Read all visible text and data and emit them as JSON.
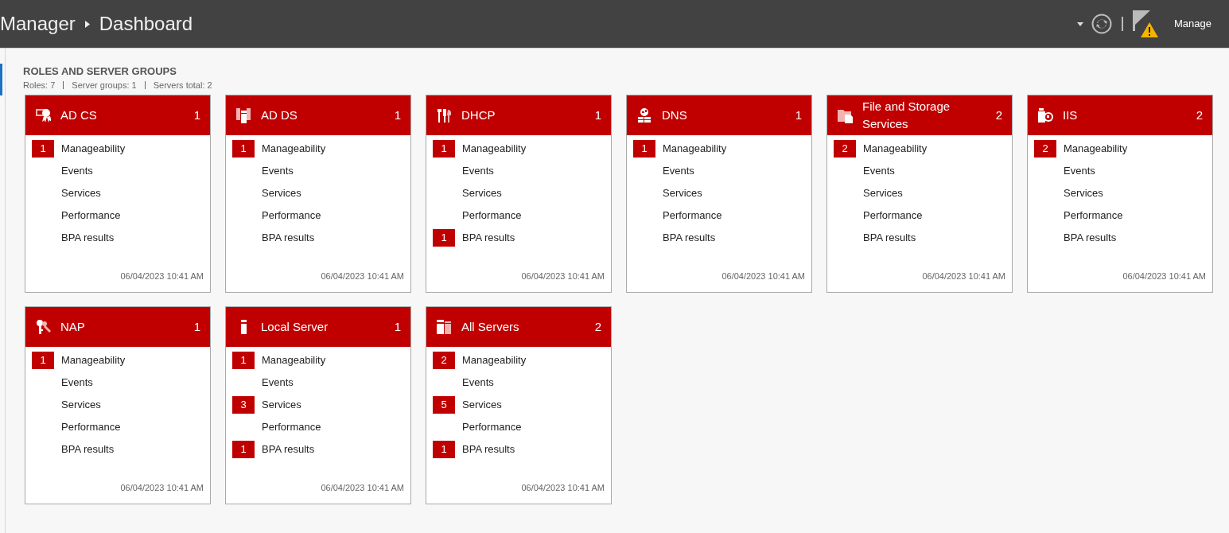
{
  "header": {
    "breadcrumb": [
      "Manager",
      "Dashboard"
    ],
    "manage_label": "Manage",
    "notification_warning": true
  },
  "section": {
    "title": "ROLES AND SERVER GROUPS",
    "summary": [
      "Roles: 7",
      "Server groups: 1",
      "Servers total: 2"
    ]
  },
  "tiles": [
    {
      "kind": "certificate",
      "title": "AD CS",
      "count": "1",
      "items": [
        {
          "label": "Manageability",
          "count": "1"
        },
        {
          "label": "Events"
        },
        {
          "label": "Services"
        },
        {
          "label": "Performance"
        },
        {
          "label": "BPA results"
        }
      ],
      "timestamp": "06/04/2023 10:41 AM"
    },
    {
      "kind": "directory",
      "title": "AD DS",
      "count": "1",
      "items": [
        {
          "label": "Manageability",
          "count": "1"
        },
        {
          "label": "Events"
        },
        {
          "label": "Services"
        },
        {
          "label": "Performance"
        },
        {
          "label": "BPA results"
        }
      ],
      "timestamp": "06/04/2023 10:41 AM"
    },
    {
      "kind": "tools",
      "title": "DHCP",
      "count": "1",
      "items": [
        {
          "label": "Manageability",
          "count": "1"
        },
        {
          "label": "Events"
        },
        {
          "label": "Services"
        },
        {
          "label": "Performance"
        },
        {
          "label": "BPA results",
          "count": "1"
        }
      ],
      "timestamp": "06/04/2023 10:41 AM"
    },
    {
      "kind": "globe-server",
      "title": "DNS",
      "count": "1",
      "items": [
        {
          "label": "Manageability",
          "count": "1"
        },
        {
          "label": "Events"
        },
        {
          "label": "Services"
        },
        {
          "label": "Performance"
        },
        {
          "label": "BPA results"
        }
      ],
      "timestamp": "06/04/2023 10:41 AM"
    },
    {
      "kind": "folder",
      "title": "File and Storage Services",
      "count": "2",
      "items": [
        {
          "label": "Manageability",
          "count": "2"
        },
        {
          "label": "Events"
        },
        {
          "label": "Services"
        },
        {
          "label": "Performance"
        },
        {
          "label": "BPA results"
        }
      ],
      "timestamp": "06/04/2023 10:41 AM"
    },
    {
      "kind": "web",
      "title": "IIS",
      "count": "2",
      "items": [
        {
          "label": "Manageability",
          "count": "2"
        },
        {
          "label": "Events"
        },
        {
          "label": "Services"
        },
        {
          "label": "Performance"
        },
        {
          "label": "BPA results"
        }
      ],
      "timestamp": "06/04/2023 10:41 AM"
    },
    {
      "kind": "keys",
      "title": "NAP",
      "count": "1",
      "items": [
        {
          "label": "Manageability",
          "count": "1"
        },
        {
          "label": "Events"
        },
        {
          "label": "Services"
        },
        {
          "label": "Performance"
        },
        {
          "label": "BPA results"
        }
      ],
      "timestamp": "06/04/2023 10:41 AM"
    },
    {
      "kind": "server",
      "title": "Local Server",
      "count": "1",
      "items": [
        {
          "label": "Manageability",
          "count": "1"
        },
        {
          "label": "Events"
        },
        {
          "label": "Services",
          "count": "3"
        },
        {
          "label": "Performance"
        },
        {
          "label": "BPA results",
          "count": "1"
        }
      ],
      "timestamp": "06/04/2023 10:41 AM"
    },
    {
      "kind": "servers",
      "title": "All Servers",
      "count": "2",
      "items": [
        {
          "label": "Manageability",
          "count": "2"
        },
        {
          "label": "Events"
        },
        {
          "label": "Services",
          "count": "5"
        },
        {
          "label": "Performance"
        },
        {
          "label": "BPA results",
          "count": "1"
        }
      ],
      "timestamp": "06/04/2023 10:41 AM"
    }
  ]
}
